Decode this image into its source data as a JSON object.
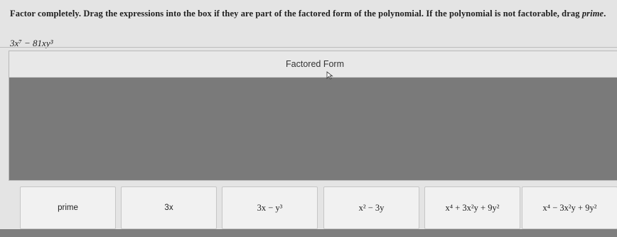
{
  "instructions": {
    "text_main": "Factor completely. Drag the expressions into the box if they are part of the factored form of the polynomial. If the polynomial is not factorable, drag",
    "text_emphasis": "prime",
    "text_end": "."
  },
  "polynomial": "3x⁷ − 81xy³",
  "answer_box": {
    "header": "Factored Form"
  },
  "tiles": [
    {
      "label": "prime"
    },
    {
      "label": "3x"
    },
    {
      "label": "3x − y³"
    },
    {
      "label": "x² − 3y"
    },
    {
      "label": "x⁴ + 3x²y + 9y²"
    },
    {
      "label": "x⁴ − 3x²y + 9y²"
    }
  ]
}
